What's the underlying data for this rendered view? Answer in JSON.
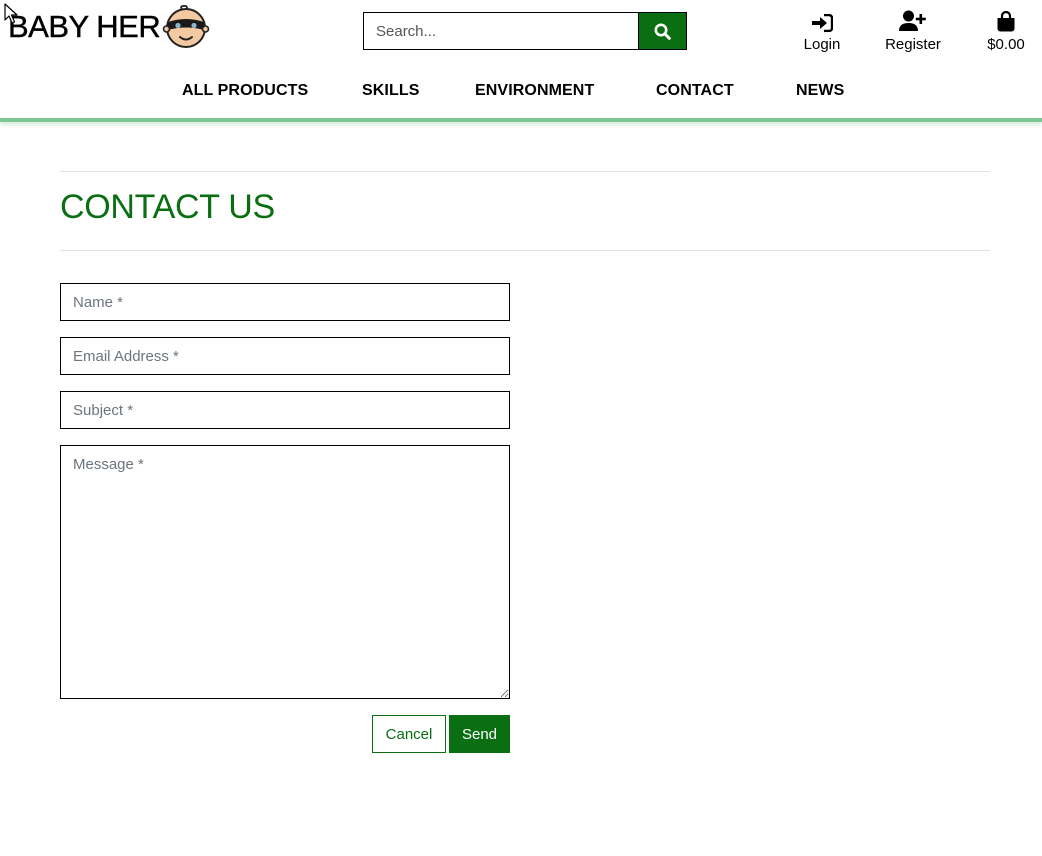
{
  "brand": {
    "name": "BABY HER",
    "logo_icon": "baby-hero-face-icon"
  },
  "search": {
    "placeholder": "Search...",
    "button_icon": "search-icon"
  },
  "account": {
    "login_label": "Login",
    "register_label": "Register",
    "cart_total": "$0.00"
  },
  "nav": {
    "items": [
      {
        "label": "ALL PRODUCTS"
      },
      {
        "label": "SKILLS"
      },
      {
        "label": "ENVIRONMENT"
      },
      {
        "label": "CONTACT"
      },
      {
        "label": "NEWS"
      }
    ]
  },
  "page": {
    "title": "CONTACT US"
  },
  "form": {
    "name_placeholder": "Name *",
    "email_placeholder": "Email Address *",
    "subject_placeholder": "Subject *",
    "message_placeholder": "Message *",
    "cancel_label": "Cancel",
    "send_label": "Send"
  },
  "colors": {
    "accent_green": "#0a6e12",
    "header_line": "#7cc796"
  }
}
